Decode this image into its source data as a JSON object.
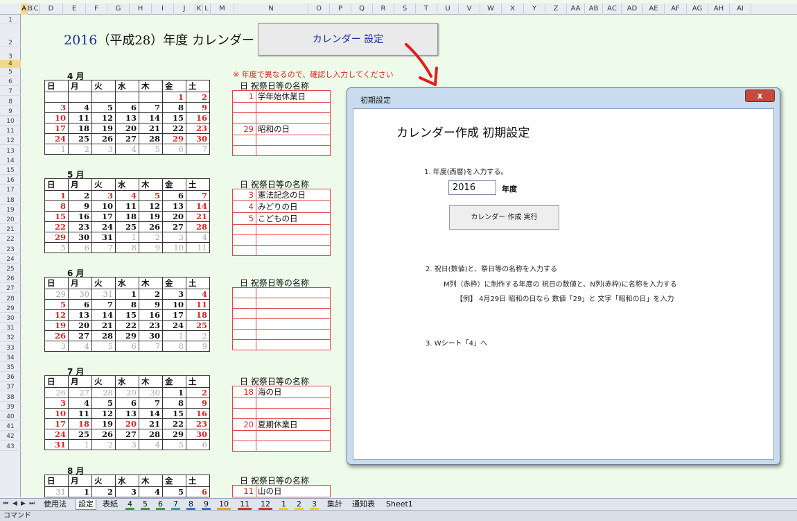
{
  "sheet": {
    "title_year": "2016",
    "title_rest": "（平成28）年度  カレンダー",
    "settings_button": "カレンダー 設定",
    "notice": "※ 年度で異なるので、確認し入力してください"
  },
  "columns": [
    "A",
    "B",
    "C",
    "D",
    "E",
    "F",
    "G",
    "H",
    "I",
    "J",
    "K",
    "L",
    "M",
    "N",
    "O",
    "P",
    "Q",
    "R",
    "S",
    "T",
    "U",
    "V",
    "W",
    "X",
    "Y",
    "Z",
    "AA",
    "AB",
    "AC",
    "AD",
    "AE",
    "AF",
    "AG",
    "AH",
    "AI"
  ],
  "weekday_headers": [
    "日",
    "月",
    "火",
    "水",
    "木",
    "金",
    "土"
  ],
  "holiday_header": "日  祝祭日等の名称",
  "months": [
    {
      "label": "4 月",
      "weeks": [
        [
          "",
          "",
          "",
          "",
          "",
          "1",
          "2"
        ],
        [
          "3",
          "4",
          "5",
          "6",
          "7",
          "8",
          "9"
        ],
        [
          "10",
          "11",
          "12",
          "13",
          "14",
          "15",
          "16"
        ],
        [
          "17",
          "18",
          "19",
          "20",
          "21",
          "22",
          "23"
        ],
        [
          "24",
          "25",
          "26",
          "27",
          "28",
          "29",
          "30"
        ],
        [
          "1",
          "2",
          "3",
          "4",
          "5",
          "6",
          "7"
        ]
      ],
      "holidays": [
        [
          "1",
          "学年始休業日"
        ],
        [
          "",
          ""
        ],
        [
          "",
          ""
        ],
        [
          "29",
          "昭和の日"
        ],
        [
          "",
          ""
        ],
        [
          "",
          ""
        ]
      ]
    },
    {
      "label": "5 月",
      "weeks": [
        [
          "1",
          "2",
          "3",
          "4",
          "5",
          "6",
          "7"
        ],
        [
          "8",
          "9",
          "10",
          "11",
          "12",
          "13",
          "14"
        ],
        [
          "15",
          "16",
          "17",
          "18",
          "19",
          "20",
          "21"
        ],
        [
          "22",
          "23",
          "24",
          "25",
          "26",
          "27",
          "28"
        ],
        [
          "29",
          "30",
          "31",
          "1",
          "2",
          "3",
          "4"
        ],
        [
          "5",
          "6",
          "7",
          "8",
          "9",
          "10",
          "11"
        ]
      ],
      "holidays": [
        [
          "3",
          "憲法記念の日"
        ],
        [
          "4",
          "みどりの日"
        ],
        [
          "5",
          "こどもの日"
        ],
        [
          "",
          ""
        ],
        [
          "",
          ""
        ],
        [
          "",
          ""
        ]
      ]
    },
    {
      "label": "6 月",
      "weeks": [
        [
          "29",
          "30",
          "31",
          "1",
          "2",
          "3",
          "4"
        ],
        [
          "5",
          "6",
          "7",
          "8",
          "9",
          "10",
          "11"
        ],
        [
          "12",
          "13",
          "14",
          "15",
          "16",
          "17",
          "18"
        ],
        [
          "19",
          "20",
          "21",
          "22",
          "23",
          "24",
          "25"
        ],
        [
          "26",
          "27",
          "28",
          "29",
          "30",
          "1",
          "2"
        ],
        [
          "3",
          "4",
          "5",
          "6",
          "7",
          "8",
          "9"
        ]
      ],
      "holidays": [
        [
          "",
          ""
        ],
        [
          "",
          ""
        ],
        [
          "",
          ""
        ],
        [
          "",
          ""
        ],
        [
          "",
          ""
        ],
        [
          "",
          ""
        ]
      ]
    },
    {
      "label": "7 月",
      "weeks": [
        [
          "26",
          "27",
          "28",
          "29",
          "30",
          "1",
          "2"
        ],
        [
          "3",
          "4",
          "5",
          "6",
          "7",
          "8",
          "9"
        ],
        [
          "10",
          "11",
          "12",
          "13",
          "14",
          "15",
          "16"
        ],
        [
          "17",
          "18",
          "19",
          "20",
          "21",
          "22",
          "23"
        ],
        [
          "24",
          "25",
          "26",
          "27",
          "28",
          "29",
          "30"
        ],
        [
          "31",
          "1",
          "2",
          "3",
          "4",
          "5",
          "6"
        ]
      ],
      "holidays": [
        [
          "18",
          "海の日"
        ],
        [
          "",
          ""
        ],
        [
          "",
          ""
        ],
        [
          "20",
          "夏期休業日"
        ],
        [
          "",
          ""
        ],
        [
          "",
          ""
        ]
      ]
    },
    {
      "label": "8 月",
      "weeks": [
        [
          "31",
          "1",
          "2",
          "3",
          "4",
          "5",
          "6"
        ]
      ],
      "holidays": [
        [
          "11",
          "山の日"
        ]
      ]
    }
  ],
  "dialog": {
    "title": "初期設定",
    "close": "x",
    "heading": "カレンダー作成    初期設定",
    "step1": "1.  年度(西暦)を入力する。",
    "year_value": "2016",
    "year_suffix": "年度",
    "run_button": "カレンダー  作成  実行",
    "step2": "2. 祝日(数値)と、祭日等の名称を入力する",
    "step2_sub": "M列（赤枠）に制作する年度の 祝日の数値と、N列(赤枠)に名称を入力する",
    "step2_example": "【例】 4月29日  昭和の日なら  数値「29」と  文字「昭和の日」を入力",
    "step3": "3. Wシート「4」へ"
  },
  "tabs": [
    "使用法",
    "設定",
    "表紙",
    "4",
    "5",
    "6",
    "7",
    "8",
    "9",
    "10",
    "11",
    "12",
    "1",
    "2",
    "3",
    "集計",
    "通知表",
    "Sheet1"
  ],
  "tab_colors": {
    "green": "#3a9b3a",
    "teal": "#2aa6a0",
    "blue": "#3a6fd6",
    "orange": "#f0a020",
    "red": "#d03030",
    "yellow": "#e8d020"
  },
  "status": "コマンド"
}
